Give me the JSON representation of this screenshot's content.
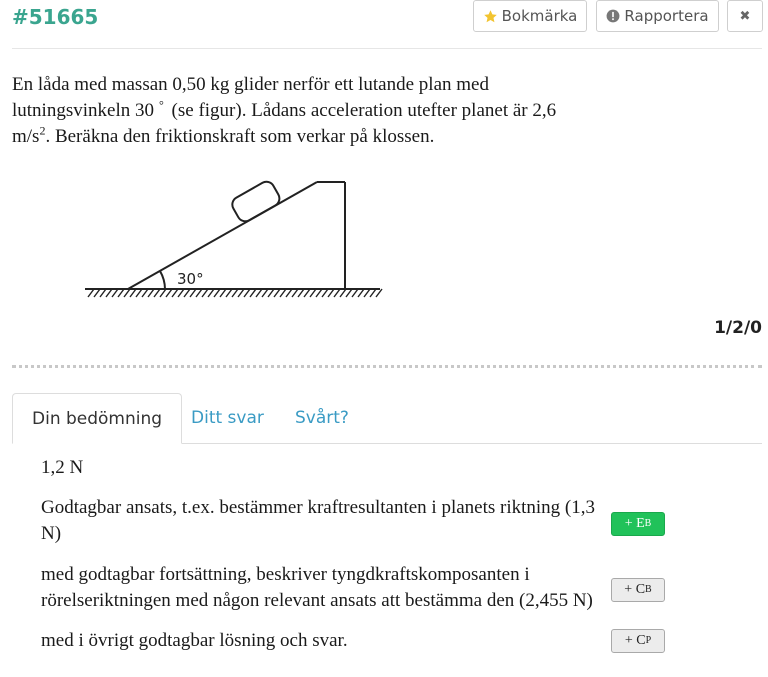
{
  "header": {
    "problem_id": "#51665",
    "bookmark_label": "Bokmärka",
    "report_label": "Rapportera",
    "close_symbol": "✖"
  },
  "problem": {
    "line1": "En låda med massan 0,50 kg glider nerför ett lutande plan med",
    "line2_a": "lutningsvinkeln 30",
    "line2_deg": "°",
    "line2_b": " (se figur). Lådans acceleration utefter planet är 2,6",
    "line3_unit": "m/s",
    "line3_exp": "2",
    "line3_b": ". Beräkna den friktionskraft som verkar på klossen.",
    "figure_angle_label": "30°"
  },
  "points": "1/2/0",
  "tabs": [
    {
      "label": "Din bedömning",
      "active": true
    },
    {
      "label": "Ditt svar",
      "active": false
    },
    {
      "label": "Svårt?",
      "active": false
    }
  ],
  "assessment": {
    "answer": "1,2 N",
    "criteria": [
      {
        "text": "Godtagbar ansats, t.ex. bestämmer kraftresultanten i planets riktning (1,3 N)",
        "button": "+ E",
        "sub": "B",
        "active": true
      },
      {
        "text": "med godtagbar fortsättning, beskriver tyngdkraftskomposanten i rörelseriktningen med någon relevant ansats att bestämma den (2,455 N)",
        "button": "+ C",
        "sub": "B",
        "active": false
      },
      {
        "text": "med i övrigt godtagbar lösning och svar.",
        "button": "+ C",
        "sub": "P",
        "active": false
      }
    ]
  },
  "colors": {
    "accent": "#3aa58f",
    "tab_link": "#3a9bc4",
    "grade_active": "#21c25a",
    "star": "#f2c430"
  },
  "icons": [
    "star-icon",
    "exclamation-circle-icon",
    "close-icon"
  ]
}
